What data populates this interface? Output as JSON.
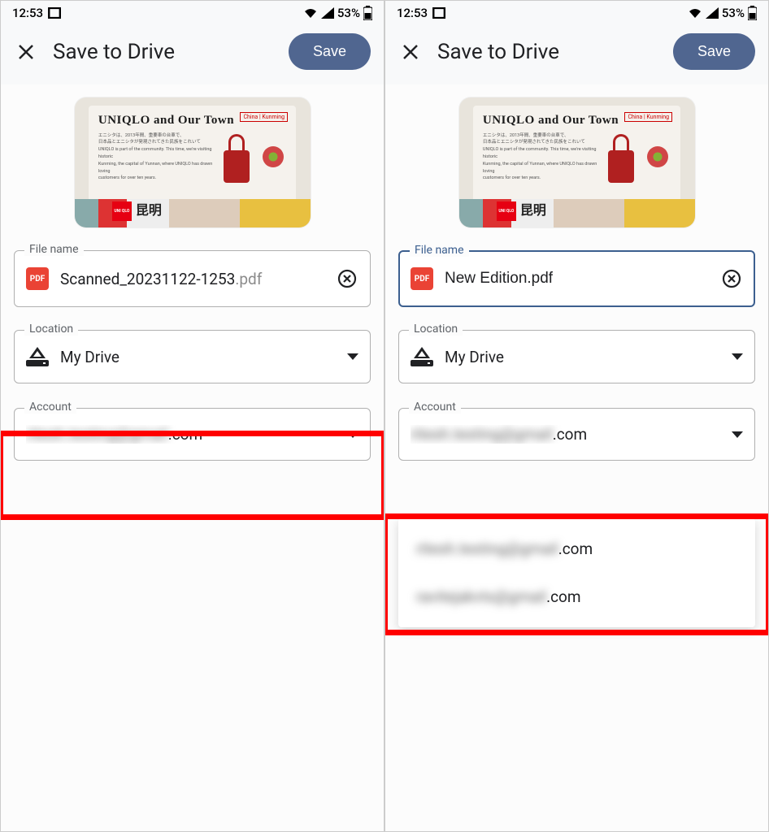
{
  "status": {
    "time": "12:53",
    "battery_pct": "53%"
  },
  "header": {
    "title": "Save to Drive",
    "save_label": "Save"
  },
  "preview": {
    "title": "UNIQLO and Our Town",
    "red_tag": "China | Kunming",
    "uniqlo_block": "UNI QLO",
    "cjk": "昆明"
  },
  "labels": {
    "filename": "File name",
    "location": "Location",
    "account": "Account",
    "pdf": "PDF"
  },
  "left": {
    "filename": "Scanned_20231122-1253",
    "file_ext": ".pdf",
    "location": "My Drive",
    "account_blur": "ritesh.testing@gmail",
    "account_suffix": ".com"
  },
  "right": {
    "filename": "New Edition.pdf",
    "location": "My Drive",
    "account_blur": "ritesh.testing@gmail",
    "account_suffix": ".com",
    "options": [
      {
        "blur": "ritesh.testing@gmail",
        "suffix": ".com"
      },
      {
        "blur": "ravitejakvts@gmail",
        "suffix": ".com"
      }
    ]
  }
}
